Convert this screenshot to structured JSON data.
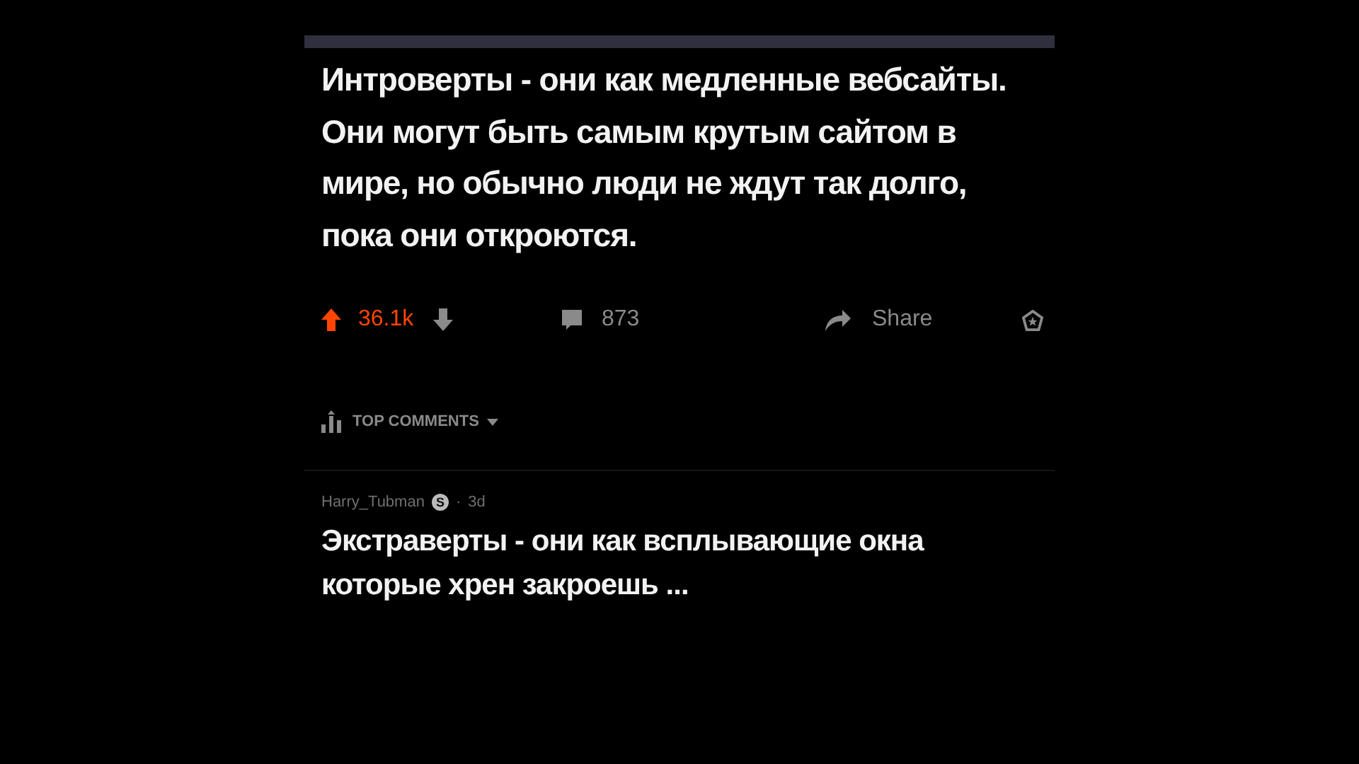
{
  "post": {
    "title": "Интроверты - они как медленные вебсайты. Они могут быть самым крутым сайтом в мире, но обычно люди не ждут так долго, пока они откроются.",
    "upvoted": true,
    "score": "36.1k",
    "comments": "873",
    "share": "Share"
  },
  "sort": {
    "label": "TOP COMMENTS"
  },
  "comments": [
    {
      "author": "Harry_Tubman",
      "badge": "S",
      "separator": "·",
      "age": "3d",
      "text": "Экстраверты - они как всплывающие окна которые хрен закроешь ..."
    }
  ]
}
